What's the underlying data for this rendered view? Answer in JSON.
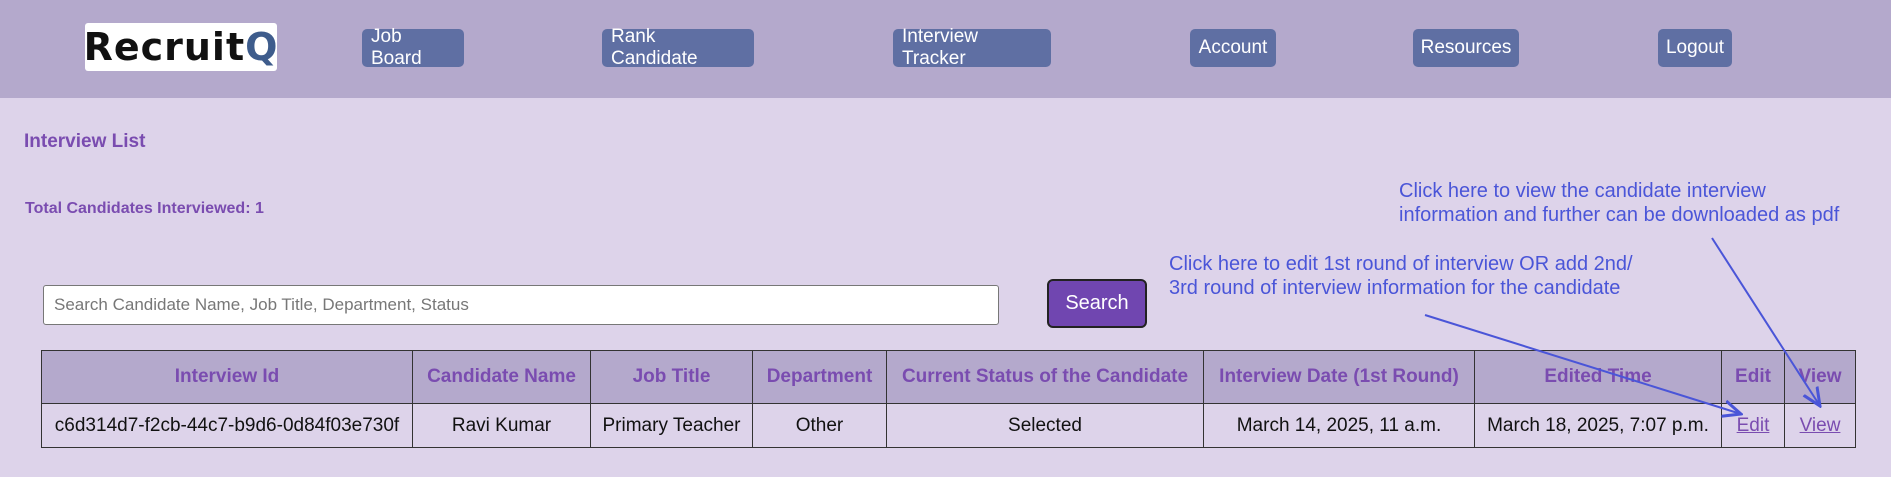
{
  "header": {
    "logo_prefix": "Recruit",
    "logo_q": "Q",
    "nav": [
      {
        "label": "Job Board"
      },
      {
        "label": "Rank Candidate"
      },
      {
        "label": "Interview Tracker"
      },
      {
        "label": "Account"
      },
      {
        "label": "Resources"
      },
      {
        "label": "Logout"
      }
    ]
  },
  "main": {
    "title": "Interview List",
    "total_label": "Total Candidates Interviewed: 1",
    "search": {
      "placeholder": "Search Candidate Name, Job Title, Department, Status",
      "button_label": "Search"
    },
    "table": {
      "headers": [
        "Interview Id",
        "Candidate Name",
        "Job Title",
        "Department",
        "Current Status of the Candidate",
        "Interview Date (1st Round)",
        "Edited Time",
        "Edit",
        "View"
      ],
      "rows": [
        {
          "interview_id": "c6d314d7-f2cb-44c7-b9d6-0d84f03e730f",
          "candidate_name": "Ravi Kumar",
          "job_title": "Primary Teacher",
          "department": "Other",
          "status": "Selected",
          "interview_date": "March 14, 2025, 11 a.m.",
          "edited_time": "March 18, 2025, 7:07 p.m.",
          "edit_label": "Edit",
          "view_label": "View"
        }
      ]
    }
  },
  "annotations": {
    "view_line1": "Click here to view the candidate interview",
    "view_line2": "information and further can be downloaded as pdf",
    "edit_line1": "Click here to edit 1st round of interview OR add 2nd/",
    "edit_line2": "3rd round of interview information for the candidate"
  },
  "colors": {
    "topbar": "#b4a9cc",
    "page_bg": "#ddd3ea",
    "nav_button": "#5f6fa3",
    "accent_text": "#7a4cb0",
    "search_button": "#7046b0",
    "annotation": "#4a55d8"
  }
}
